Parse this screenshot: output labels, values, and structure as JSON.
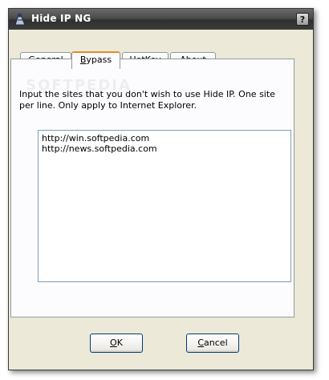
{
  "window": {
    "title": "Hide IP NG",
    "help_label": "?"
  },
  "tabs": [
    {
      "label_first": "G",
      "label_rest": "eneral"
    },
    {
      "label_first": "B",
      "label_rest": "ypass",
      "active": true
    },
    {
      "label_first": "H",
      "label_rest": "otKey"
    },
    {
      "label_first": "A",
      "label_rest": "bout"
    }
  ],
  "bypass": {
    "instructions": "Input the sites that you don't wish to use Hide IP. One site per line. Only apply to Internet Explorer.",
    "sites": [
      "http://win.softpedia.com",
      "http://news.softpedia.com"
    ]
  },
  "buttons": {
    "ok_first": "O",
    "ok_rest": "K",
    "cancel_first": "C",
    "cancel_rest": "ancel"
  },
  "watermark": "SOFTPEDIA",
  "colors": {
    "accent_tab": "#e68b2c",
    "dialog_bg": "#ece9d8"
  }
}
